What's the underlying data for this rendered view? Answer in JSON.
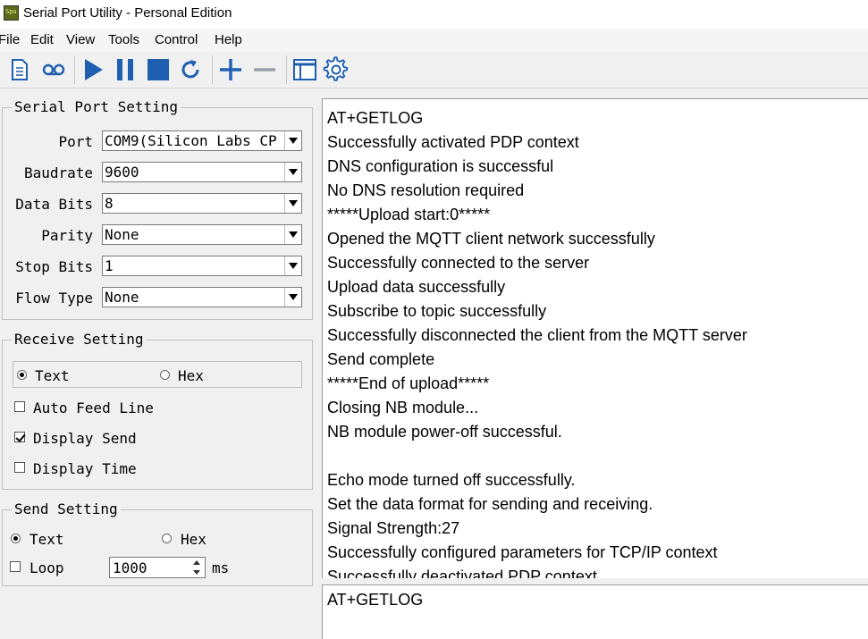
{
  "window": {
    "title": "Serial Port Utility - Personal Edition",
    "icon": "app-logo-icon",
    "icon_text": "Spu"
  },
  "menu": [
    "File",
    "Edit",
    "View",
    "Tools",
    "Control",
    "Help"
  ],
  "toolbar": {
    "icons": [
      "document-icon",
      "record-icon",
      "play-icon",
      "pause-icon",
      "stop-icon",
      "refresh-icon",
      "add-icon",
      "minus-icon",
      "window-icon",
      "gear-icon"
    ],
    "accent": "#1f5fb0"
  },
  "serial_port_setting": {
    "title": "Serial Port Setting",
    "fields": [
      {
        "label": "Port",
        "value": "COM9(Silicon Labs CP"
      },
      {
        "label": "Baudrate",
        "value": "9600"
      },
      {
        "label": "Data Bits",
        "value": "8"
      },
      {
        "label": "Parity",
        "value": "None"
      },
      {
        "label": "Stop Bits",
        "value": "1"
      },
      {
        "label": "Flow Type",
        "value": "None"
      }
    ]
  },
  "receive_setting": {
    "title": "Receive Setting",
    "text_option": "Text",
    "hex_option": "Hex",
    "selected": "Text",
    "auto_feed_line": {
      "label": "Auto Feed Line",
      "checked": false
    },
    "display_send": {
      "label": "Display Send",
      "checked": true
    },
    "display_time": {
      "label": "Display Time",
      "checked": false
    }
  },
  "send_setting": {
    "title": "Send Setting",
    "text_option": "Text",
    "hex_option": "Hex",
    "selected": "Text",
    "loop": {
      "label": "Loop",
      "checked": false
    },
    "interval": "1000",
    "unit": "ms"
  },
  "receive_log": [
    "AT+GETLOG",
    "Successfully activated PDP context",
    "DNS configuration is successful",
    "No DNS resolution required",
    "*****Upload start:0*****",
    "Opened the MQTT client network successfully",
    "Successfully connected to the server",
    "Upload data successfully",
    "Subscribe to topic successfully",
    "Successfully disconnected the client from the MQTT server",
    "Send complete",
    "*****End of upload*****",
    "Closing NB module...",
    "NB module power-off successful.",
    "",
    "Echo mode turned off successfully.",
    "Set the data format for sending and receiving.",
    "Signal Strength:27",
    "Successfully configured parameters for TCP/IP context",
    "Successfully deactivated PDP context"
  ],
  "send_input": "AT+GETLOG"
}
